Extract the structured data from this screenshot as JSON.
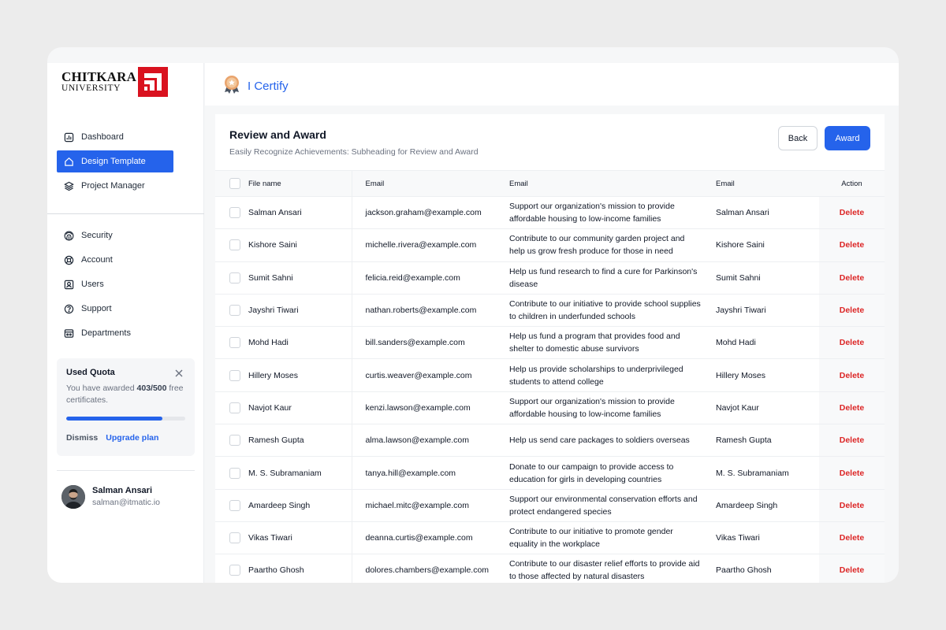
{
  "brand": {
    "logo_main": "CHITKARA",
    "logo_sub": "UNIVERSITY",
    "app_title": "I Certify",
    "accent": "#2563eb",
    "logo_red": "#d9121f"
  },
  "sidebar": {
    "nav_primary": [
      {
        "label": "Dashboard",
        "icon": "chart-icon",
        "active": false
      },
      {
        "label": "Design Template",
        "icon": "home-icon",
        "active": true
      },
      {
        "label": "Project Manager",
        "icon": "layers-icon",
        "active": false
      }
    ],
    "nav_secondary": [
      {
        "label": "Security",
        "icon": "fingerprint-icon"
      },
      {
        "label": "Account",
        "icon": "lifebuoy-icon"
      },
      {
        "label": "Users",
        "icon": "user-card-icon"
      },
      {
        "label": "Support",
        "icon": "help-circle-icon"
      },
      {
        "label": "Departments",
        "icon": "building-icon"
      }
    ],
    "quota": {
      "title": "Used Quota",
      "text_prefix": "You have awarded ",
      "count": "403/500",
      "text_suffix": " free certificates.",
      "progress": 0.806,
      "dismiss_label": "Dismiss",
      "upgrade_label": "Upgrade plan"
    },
    "user": {
      "name": "Salman Ansari",
      "email": "salman@itmatic.io"
    }
  },
  "main": {
    "title": "Review and Award",
    "subtitle": "Easily Recognize Achievements: Subheading for Review and Award",
    "back_label": "Back",
    "award_label": "Award",
    "columns": [
      "File name",
      "Email",
      "Email",
      "Email",
      "Action"
    ],
    "rows": [
      {
        "name": "Salman Ansari",
        "email": "jackson.graham@example.com",
        "desc": "Support our organization's mission to provide affordable housing to low-income families",
        "name2": "Salman Ansari",
        "action": "Delete"
      },
      {
        "name": "Kishore Saini",
        "email": "michelle.rivera@example.com",
        "desc": "Contribute to our community garden project and help us grow fresh produce for those in need",
        "name2": "Kishore Saini",
        "action": "Delete"
      },
      {
        "name": "Sumit Sahni",
        "email": "felicia.reid@example.com",
        "desc": "Help us fund research to find a cure for Parkinson's disease",
        "name2": "Sumit Sahni",
        "action": "Delete"
      },
      {
        "name": "Jayshri Tiwari",
        "email": "nathan.roberts@example.com",
        "desc": "Contribute to our initiative to provide school supplies to children in underfunded schools",
        "name2": "Jayshri Tiwari",
        "action": "Delete"
      },
      {
        "name": "Mohd Hadi",
        "email": "bill.sanders@example.com",
        "desc": "Help us fund a program that provides food and shelter to domestic abuse survivors",
        "name2": "Mohd Hadi",
        "action": "Delete"
      },
      {
        "name": "Hillery Moses",
        "email": "curtis.weaver@example.com",
        "desc": "Help us provide scholarships to underprivileged students to attend college",
        "name2": "Hillery Moses",
        "action": "Delete"
      },
      {
        "name": "Navjot Kaur",
        "email": "kenzi.lawson@example.com",
        "desc": "Support our organization's mission to provide affordable housing to low-income families",
        "name2": "Navjot Kaur",
        "action": "Delete"
      },
      {
        "name": "Ramesh Gupta",
        "email": "alma.lawson@example.com",
        "desc": "Help us send care packages to soldiers overseas",
        "name2": "Ramesh Gupta",
        "action": "Delete"
      },
      {
        "name": "M. S. Subramaniam",
        "email": "tanya.hill@example.com",
        "desc": "Donate to our campaign to provide access to education for girls in developing countries",
        "name2": "M. S. Subramaniam",
        "action": "Delete"
      },
      {
        "name": "Amardeep Singh",
        "email": "michael.mitc@example.com",
        "desc": "Support our environmental conservation efforts and protect endangered species",
        "name2": "Amardeep Singh",
        "action": "Delete"
      },
      {
        "name": "Vikas Tiwari",
        "email": "deanna.curtis@example.com",
        "desc": "Contribute to our initiative to promote gender equality in the workplace",
        "name2": "Vikas Tiwari",
        "action": "Delete"
      },
      {
        "name": "Paartho Ghosh",
        "email": "dolores.chambers@example.com",
        "desc": "Contribute to our disaster relief efforts to provide aid to those affected by natural disasters",
        "name2": "Paartho Ghosh",
        "action": "Delete"
      }
    ]
  }
}
